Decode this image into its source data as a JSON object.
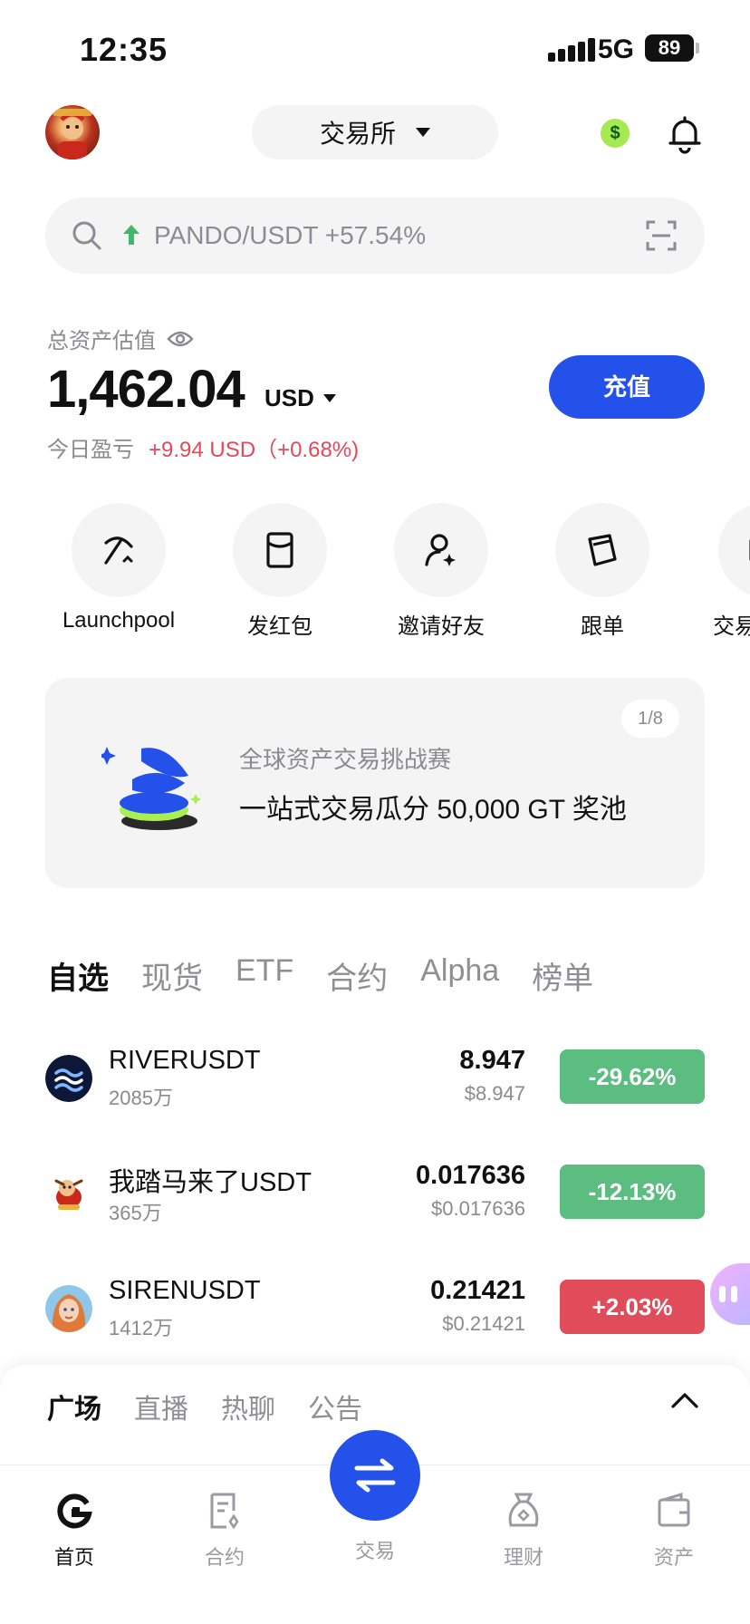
{
  "status_bar": {
    "time": "12:35",
    "network": "5G",
    "battery": "89"
  },
  "header": {
    "exchange_label": "交易所"
  },
  "search": {
    "text": "PANDO/USDT +57.54%"
  },
  "assets": {
    "label": "总资产估值",
    "amount": "1,462.04",
    "currency": "USD",
    "pnl_label": "今日盈亏",
    "pnl_value": "+9.94 USD（+0.68%)",
    "deposit_label": "充值"
  },
  "shortcuts": [
    {
      "label": "Launchpool",
      "icon": "pickaxe-icon"
    },
    {
      "label": "发红包",
      "icon": "red-envelope-icon"
    },
    {
      "label": "邀请好友",
      "icon": "invite-user-icon"
    },
    {
      "label": "跟单",
      "icon": "copy-trade-icon"
    },
    {
      "label": "交易",
      "icon": "trade-icon"
    }
  ],
  "banner": {
    "subtitle": "全球资产交易挑战赛",
    "title": "一站式交易瓜分 50,000 GT 奖池",
    "page": "1/8"
  },
  "market_tabs": [
    "自选",
    "现货",
    "ETF",
    "合约",
    "Alpha",
    "榜单"
  ],
  "market_rows": [
    {
      "pair": "RIVERUSDT",
      "volume": "2085万",
      "price": "8.947",
      "price_usd": "$8.947",
      "change": "-29.62%",
      "color": "#5bbd7f"
    },
    {
      "pair": "我踏马来了USDT",
      "volume": "365万",
      "price": "0.017636",
      "price_usd": "$0.017636",
      "change": "-12.13%",
      "color": "#5bbd7f"
    },
    {
      "pair": "SIRENUSDT",
      "volume": "1412万",
      "price": "0.21421",
      "price_usd": "$0.21421",
      "change": "+2.03%",
      "color": "#e14c5b"
    }
  ],
  "feed_tabs": [
    "广场",
    "直播",
    "热聊",
    "公告"
  ],
  "bottom_nav": {
    "home": "首页",
    "futures": "合约",
    "trade": "交易",
    "earn": "理财",
    "assets": "资产"
  },
  "colors": {
    "accent": "#2351ea",
    "down": "#5bbd7f",
    "up": "#e14c5b"
  }
}
